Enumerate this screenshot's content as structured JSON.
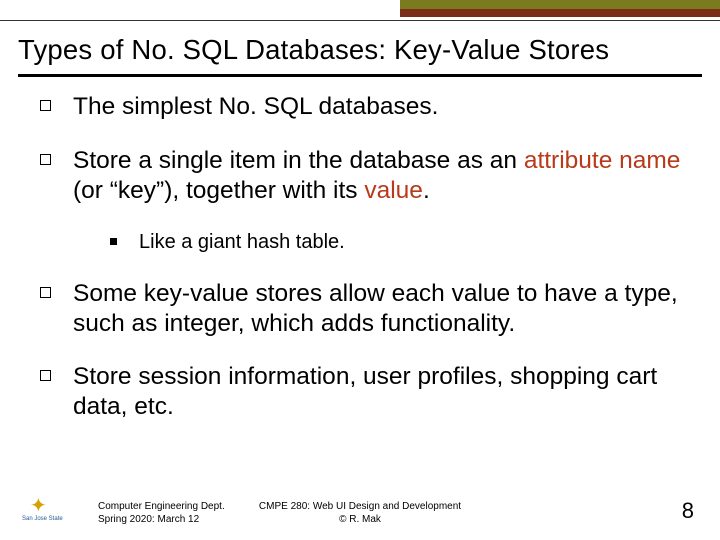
{
  "title": "Types of No. SQL Databases: Key-Value Stores",
  "bullets": {
    "b1": "The simplest No. SQL databases.",
    "b2_pre": "Store a single item in the database as an ",
    "b2_name": "attribute name",
    "b2_mid": " (or “key”), together with its ",
    "b2_value": "value",
    "b2_post": ".",
    "b2_sub": "Like a giant hash table.",
    "b3": "Some key-value stores allow each value to have a type, such as integer, which adds functionality.",
    "b4": "Store session information, user profiles, shopping cart data, etc."
  },
  "footer": {
    "left_line1": "Computer Engineering Dept.",
    "left_line2": "Spring 2020: March 12",
    "center_line1": "CMPE 280: Web UI Design and Development",
    "center_line2": "© R. Mak",
    "page": "8",
    "logo_text": "San Jose State"
  }
}
